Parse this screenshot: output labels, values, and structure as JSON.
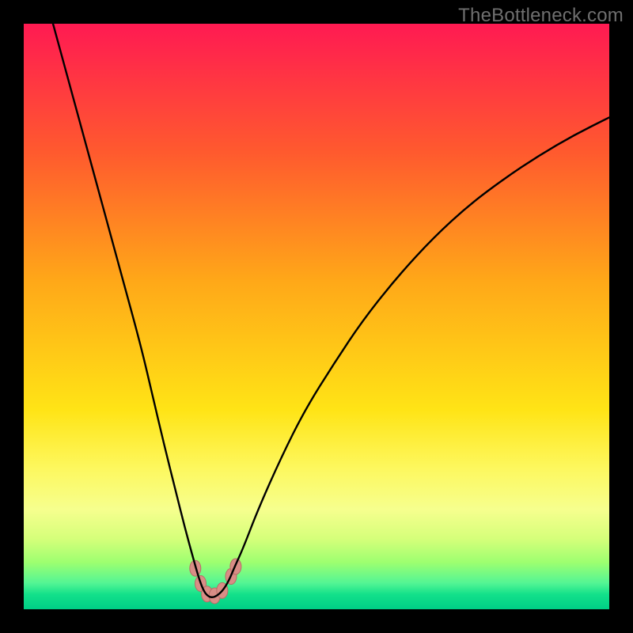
{
  "watermark": "TheBottleneck.com",
  "chart_data": {
    "type": "line",
    "title": "",
    "xlabel": "",
    "ylabel": "",
    "xlim": [
      0,
      100
    ],
    "ylim": [
      0,
      100
    ],
    "grid": false,
    "legend": false,
    "background_gradient": {
      "stops": [
        {
          "pos": 0.0,
          "color": "#ff1a52"
        },
        {
          "pos": 0.22,
          "color": "#ff5a2e"
        },
        {
          "pos": 0.44,
          "color": "#ffa818"
        },
        {
          "pos": 0.66,
          "color": "#ffe416"
        },
        {
          "pos": 0.76,
          "color": "#fdf85f"
        },
        {
          "pos": 0.83,
          "color": "#f6ff8e"
        },
        {
          "pos": 0.88,
          "color": "#d5ff7a"
        },
        {
          "pos": 0.92,
          "color": "#9dff70"
        },
        {
          "pos": 0.955,
          "color": "#54f594"
        },
        {
          "pos": 0.975,
          "color": "#12e08a"
        },
        {
          "pos": 1.0,
          "color": "#00cf86"
        }
      ]
    },
    "series": [
      {
        "name": "bottleneck-curve",
        "color": "#000000",
        "width": 2.4,
        "x": [
          5,
          8,
          11,
          14,
          17,
          20,
          22,
          24,
          26,
          27.5,
          29,
          30,
          30.8,
          31.5,
          32.2,
          33,
          34,
          35,
          36,
          37.5,
          40,
          44,
          48,
          53,
          58,
          64,
          70,
          76,
          82,
          88,
          94,
          100
        ],
        "y": [
          100,
          89,
          78,
          67,
          56,
          45,
          36.5,
          28,
          20,
          14,
          8.5,
          5,
          3.0,
          2.2,
          2.0,
          2.3,
          3.2,
          4.8,
          7.2,
          10.5,
          17,
          26,
          34,
          42,
          49.5,
          57,
          63.5,
          69,
          73.5,
          77.5,
          81,
          84
        ]
      }
    ],
    "markers": {
      "name": "bottleneck-markers",
      "color": "#d98d86",
      "stroke": "#b86d66",
      "radius_x": 7,
      "radius_y": 10,
      "points": [
        {
          "x": 29.3,
          "y": 7.0
        },
        {
          "x": 30.2,
          "y": 4.4
        },
        {
          "x": 31.3,
          "y": 2.6
        },
        {
          "x": 32.6,
          "y": 2.3
        },
        {
          "x": 33.9,
          "y": 3.2
        },
        {
          "x": 35.4,
          "y": 5.6
        },
        {
          "x": 36.2,
          "y": 7.3
        }
      ]
    }
  }
}
